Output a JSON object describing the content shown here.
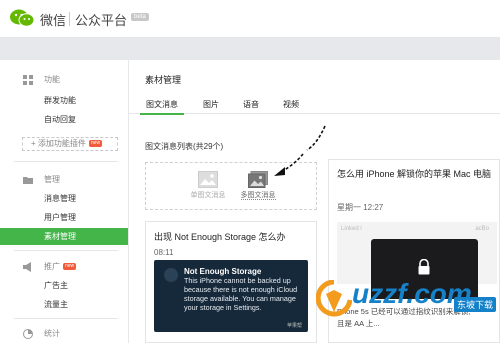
{
  "header": {
    "logo_text": "微信",
    "logo_sub": "公众平台",
    "beta_badge": "beta"
  },
  "sidebar": {
    "sections": [
      {
        "label": "功能",
        "icon": "grid-icon"
      },
      {
        "label": "管理",
        "icon": "folder-icon"
      },
      {
        "label": "推广",
        "icon": "megaphone-icon"
      },
      {
        "label": "统计",
        "icon": "chart-icon"
      }
    ],
    "feature_items": [
      "群发功能",
      "自动回复"
    ],
    "add_plugin": "+ 添加功能插件",
    "manage_items": [
      "消息管理",
      "用户管理",
      "素材管理"
    ],
    "promo_items": [
      "广告主",
      "流量主"
    ],
    "new_badge": "new",
    "active_item": "素材管理",
    "accent_color": "#44b549"
  },
  "main": {
    "title": "素材管理",
    "tabs": [
      "图文消息",
      "图片",
      "语音",
      "视频"
    ],
    "active_tab": "图文消息",
    "list_label": "图文消息列表(共29个)",
    "new_single": "单图文消息",
    "new_multi": "多图文消息",
    "card1": {
      "title": "出现 Not Enough Storage 怎么办",
      "time": "08:11",
      "notif_title": "Not Enough Storage",
      "notif_body": "This iPhone cannot be backed up because there is not enough iCloud storage available. You can manage your storage in Settings.",
      "watermark": "苹果帮"
    },
    "card2": {
      "title": "怎么用 iPhone 解锁你的苹果 Mac 电脑",
      "time": "星期一 12:27",
      "img_label_left": "Linked l",
      "img_label_right": "acBo",
      "desc": "Phone 5s 已经可以通过指纹识别来解锁,",
      "desc2": "且是 AA 上..."
    }
  },
  "watermark": {
    "site": "uzzf.com",
    "tag": "东坡下载"
  }
}
